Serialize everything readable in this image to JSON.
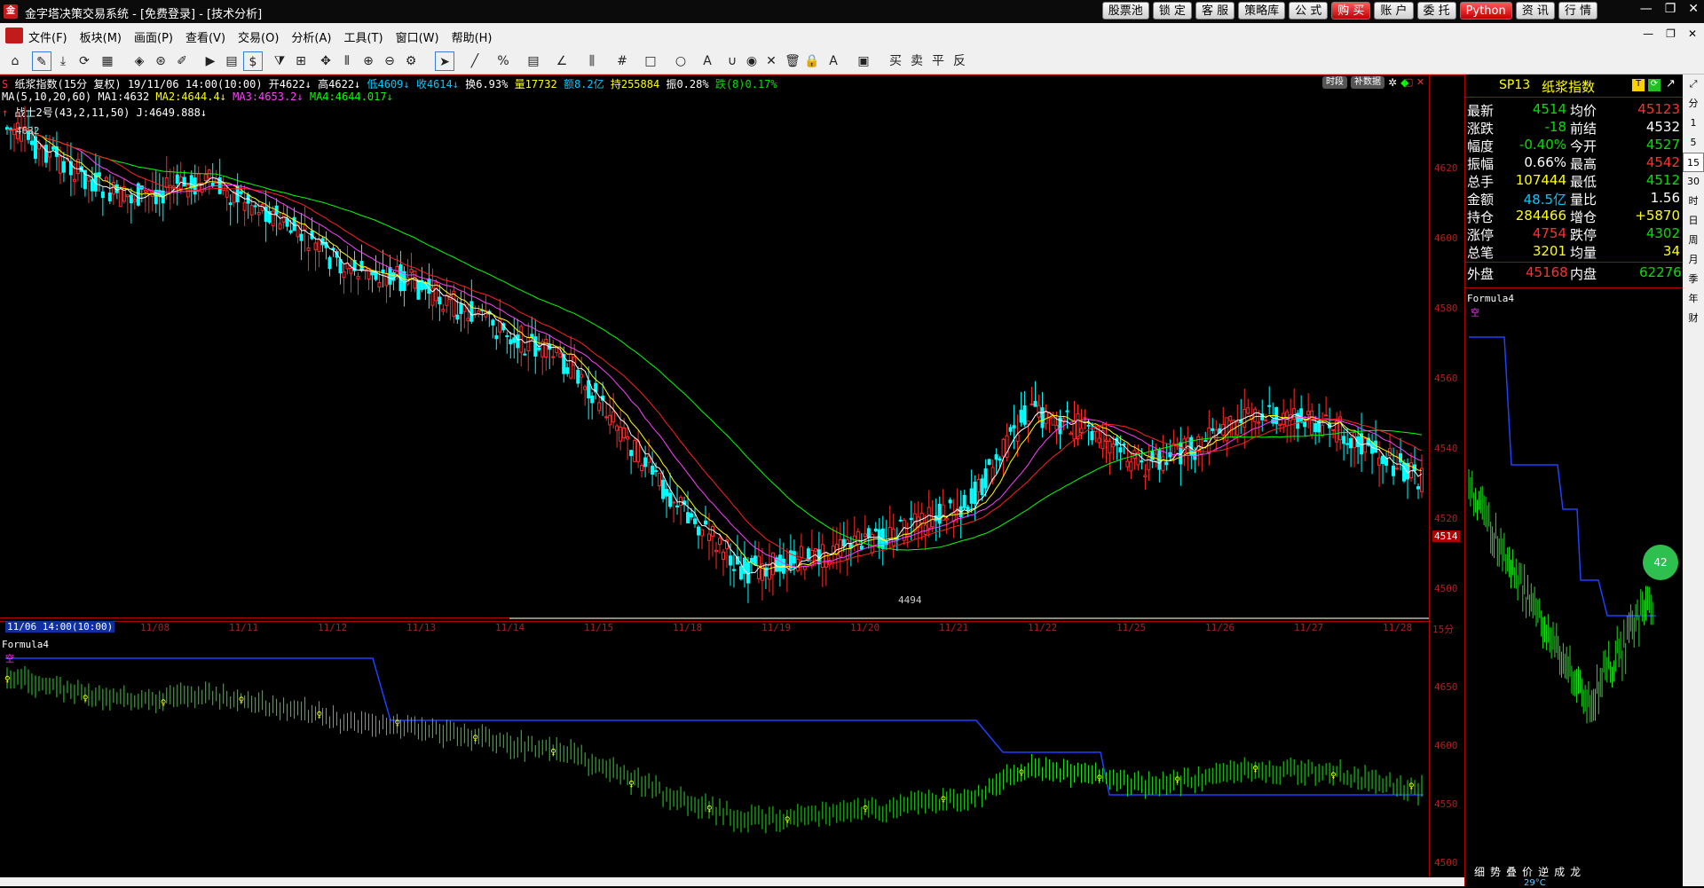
{
  "titlebar": {
    "title": "金字塔决策交易系统 - [免费登录] - [技术分析]",
    "quick_buttons": [
      "股票池",
      "锁 定",
      "客 服",
      "策略库",
      "公 式",
      "购 买",
      "账 户",
      "委 托",
      "Python",
      "资 讯",
      "行 情"
    ]
  },
  "menu": [
    "文件(F)",
    "板块(M)",
    "画面(P)",
    "查看(V)",
    "交易(O)",
    "分析(A)",
    "工具(T)",
    "窗口(W)",
    "帮助(H)"
  ],
  "chart": {
    "header": {
      "symbol": "纸浆指数(15分 复权)",
      "date": "19/11/06 14:00(10:00)",
      "open": "开4622↓",
      "high": "高4622↓",
      "low": "低4609↓",
      "close": "收4614↓",
      "turnover": "换6.93%",
      "volume": "量17732",
      "amount": "额8.2亿",
      "oi": "持255884",
      "amp": "振0.28%",
      "fall": "跌(8)0.17%"
    },
    "ma_line": {
      "label": "MA(5,10,20,60)",
      "ma1": "MA1:4632",
      "ma2": "MA2:4644.4↓",
      "ma3": "MA3:4653.2↓",
      "ma4": "MA4:4644.017↓"
    },
    "indicator_line": "战士2号(43,2,11,50) J:4649.888↓",
    "top_buttons": [
      "时段",
      "补数据"
    ],
    "high_mark": "4632",
    "low_mark": "4494",
    "price_marker": "4514",
    "price_axis": [
      "4620",
      "4600",
      "4580",
      "4560",
      "4540",
      "4520",
      "4500"
    ],
    "sub_axis": [
      "4650",
      "4600",
      "4550",
      "4500"
    ],
    "date_selected": "11/06 14:00(10:00)",
    "dates": [
      "11/08",
      "11/11",
      "11/12",
      "11/13",
      "11/14",
      "11/15",
      "11/18",
      "11/19",
      "11/20",
      "11/21",
      "11/22",
      "11/25",
      "11/26",
      "11/27",
      "11/28"
    ],
    "period": "15分",
    "sub_title": "Formula4",
    "sub_marker": "空"
  },
  "quote": {
    "code": "SP13",
    "name": "纸浆指数",
    "rows": [
      {
        "l1": "最新",
        "v1": "4514",
        "c1": "#00e000",
        "l2": "均价",
        "v2": "45123",
        "c2": "#ff3030"
      },
      {
        "l1": "涨跌",
        "v1": "-18",
        "c1": "#00e000",
        "l2": "前结",
        "v2": "4532",
        "c2": "#ffffff"
      },
      {
        "l1": "幅度",
        "v1": "-0.40%",
        "c1": "#00e000",
        "l2": "今开",
        "v2": "4527",
        "c2": "#00e000"
      },
      {
        "l1": "振幅",
        "v1": "0.66%",
        "c1": "#ffffff",
        "l2": "最高",
        "v2": "4542",
        "c2": "#ff3030"
      },
      {
        "l1": "总手",
        "v1": "107444",
        "c1": "#ffff00",
        "l2": "最低",
        "v2": "4512",
        "c2": "#00e000"
      },
      {
        "l1": "金额",
        "v1": "48.5亿",
        "c1": "#00c8ff",
        "l2": "量比",
        "v2": "1.56",
        "c2": "#ffffff"
      },
      {
        "l1": "持仓",
        "v1": "284466",
        "c1": "#ffff00",
        "l2": "增仓",
        "v2": "+5870",
        "c2": "#ffff00"
      },
      {
        "l1": "涨停",
        "v1": "4754",
        "c1": "#ff3030",
        "l2": "跌停",
        "v2": "4302",
        "c2": "#00e000"
      },
      {
        "l1": "总笔",
        "v1": "3201",
        "c1": "#ffff00",
        "l2": "均量",
        "v2": "34",
        "c2": "#ffff00"
      }
    ],
    "outer": {
      "label": "外盘",
      "value": "45168"
    },
    "inner": {
      "label": "内盘",
      "value": "62276"
    },
    "formula": "Formula4",
    "marker": "空",
    "tabs": [
      "细",
      "势",
      "叠",
      "价",
      "逆",
      "成",
      "龙"
    ],
    "weather": "29°C"
  },
  "periods": [
    "分",
    "1",
    "5",
    "15",
    "30",
    "时",
    "日",
    "周",
    "月",
    "季",
    "年",
    "财"
  ],
  "period_selected": "15",
  "colors": {
    "up": "#ff2a2a",
    "down": "#00ffff",
    "border": "#b00000",
    "blue": "#2040ff",
    "green": "#1fe01f"
  }
}
